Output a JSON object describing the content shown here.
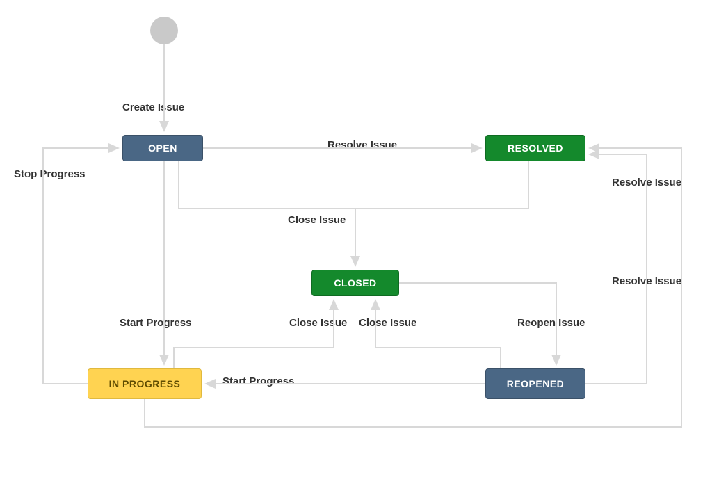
{
  "states": {
    "open": "OPEN",
    "resolved": "RESOLVED",
    "closed": "CLOSED",
    "in_progress": "IN PROGRESS",
    "reopened": "REOPENED"
  },
  "transitions": {
    "create_issue": "Create Issue",
    "resolve_issue_open": "Resolve Issue",
    "resolve_issue_inprog": "Resolve Issue",
    "resolve_issue_reop": "Resolve Issue",
    "close_issue_open": "Close Issue",
    "close_issue_resolved": "Close Issue",
    "close_issue_inprog": "Close Issue",
    "stop_progress": "Stop Progress",
    "start_progress_open": "Start Progress",
    "start_progress_reop": "Start Progress",
    "reopen_issue": "Reopen Issue"
  },
  "colors": {
    "blue": "#4a6785",
    "green": "#14892c",
    "yellow": "#ffd351",
    "edge": "#d8d8d8",
    "text": "#333333"
  }
}
